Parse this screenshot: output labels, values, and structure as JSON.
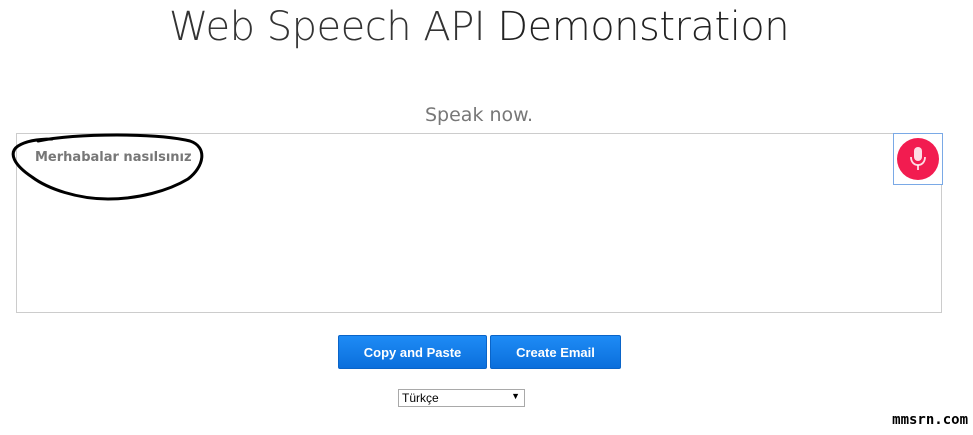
{
  "header": {
    "title_part1": "Web Speech API",
    "title_part2": "Demonstration"
  },
  "status": {
    "text": "Speak now."
  },
  "results": {
    "transcript": "Merhabalar nasılsınız"
  },
  "mic_button": {
    "icon": "microphone-icon",
    "color": "#f21c50"
  },
  "buttons": {
    "copy_label": "Copy and Paste",
    "email_label": "Create Email",
    "accent": "#0b6fdc"
  },
  "language_select": {
    "selected": "Türkçe"
  },
  "watermark": {
    "text": "mmsrn.com"
  }
}
